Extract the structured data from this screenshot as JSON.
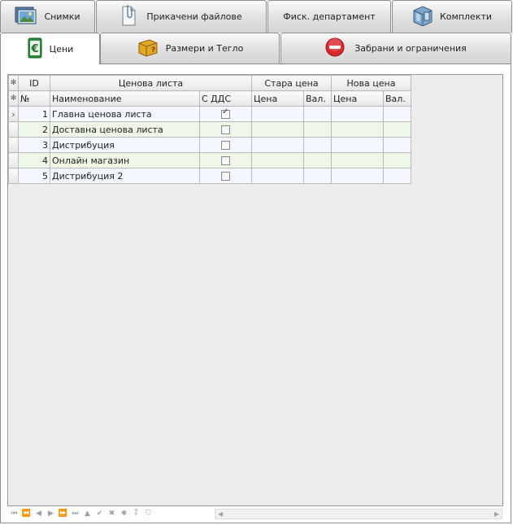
{
  "tabs_row1": [
    {
      "label": "Снимки",
      "icon": "images-icon"
    },
    {
      "label": "Прикачени файлове",
      "icon": "attachment-file-icon"
    },
    {
      "label": "Фиск. департамент",
      "icon": ""
    },
    {
      "label": "Комплекти",
      "icon": "package-kit-icon"
    }
  ],
  "tabs_row2": [
    {
      "label": "Цени",
      "icon": "euro-price-icon",
      "active": true
    },
    {
      "label": "Размери и Тегло",
      "icon": "box-dimensions-icon"
    },
    {
      "label": "Забрани и ограничения",
      "icon": "no-entry-icon"
    }
  ],
  "grid": {
    "group_headers": {
      "id": "ID",
      "price_list": "Ценова листа",
      "old_price": "Стара цена",
      "new_price": "Нова цена"
    },
    "columns": {
      "no": "№",
      "name": "Наименование",
      "vat": "С ДДС",
      "old_price": "Цена",
      "old_currency": "Вал.",
      "new_price": "Цена",
      "new_currency": "Вал."
    },
    "rows": [
      {
        "no": "1",
        "name": "Главна ценова листа",
        "vat": true,
        "old_price": "",
        "old_currency": "",
        "new_price": "",
        "new_currency": ""
      },
      {
        "no": "2",
        "name": "Доставна ценова листа",
        "vat": false,
        "old_price": "",
        "old_currency": "",
        "new_price": "",
        "new_currency": ""
      },
      {
        "no": "3",
        "name": "Дистрибуция",
        "vat": false,
        "old_price": "",
        "old_currency": "",
        "new_price": "",
        "new_currency": ""
      },
      {
        "no": "4",
        "name": "Онлайн магазин",
        "vat": false,
        "old_price": "",
        "old_currency": "",
        "new_price": "",
        "new_currency": ""
      },
      {
        "no": "5",
        "name": "Дистрибуция 2",
        "vat": false,
        "old_price": "",
        "old_currency": "",
        "new_price": "",
        "new_currency": ""
      }
    ],
    "current_row_indicator": "›"
  },
  "navigator": {
    "buttons": [
      {
        "name": "first-page-button",
        "glyph": "⏮"
      },
      {
        "name": "prev-page-button",
        "glyph": "⏪"
      },
      {
        "name": "prev-record-button",
        "glyph": "◀"
      },
      {
        "name": "next-record-button",
        "glyph": "▶"
      },
      {
        "name": "next-page-button",
        "glyph": "⏩"
      },
      {
        "name": "last-page-button",
        "glyph": "⏭"
      },
      {
        "name": "insert-button",
        "glyph": "▲"
      },
      {
        "name": "post-button",
        "glyph": "✔"
      },
      {
        "name": "cancel-button",
        "glyph": "✖"
      },
      {
        "name": "add-button",
        "glyph": "✱"
      },
      {
        "name": "add-copy-button",
        "glyph": "⁑"
      },
      {
        "name": "filter-button",
        "glyph": "⛉"
      }
    ]
  },
  "colors": {
    "odd_row": "#f4f8fe",
    "even_row": "#eef7e8",
    "grid_bg": "#ececec"
  }
}
